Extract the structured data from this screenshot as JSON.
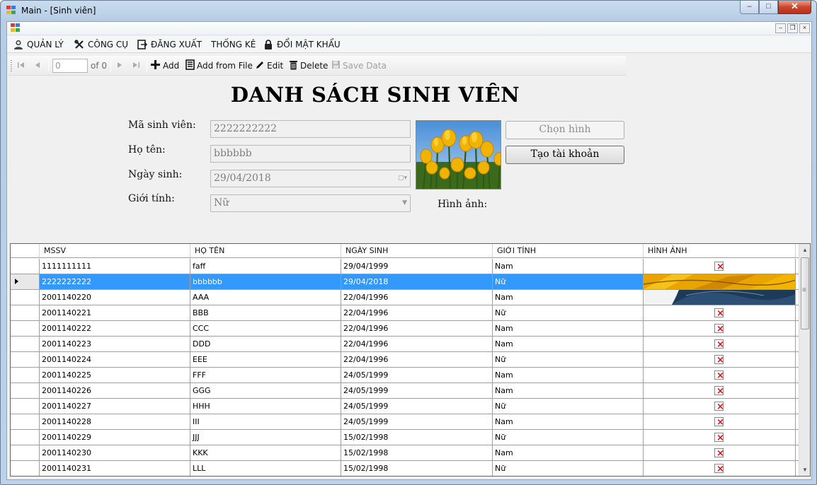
{
  "window": {
    "title": "Main - [Sinh viên]",
    "minimize": "–",
    "restore": "□",
    "close": "✕",
    "mdi_minimize": "–",
    "mdi_restore": "❐",
    "mdi_close": "×"
  },
  "menu": {
    "items": [
      {
        "label": "QUẢN LÝ",
        "icon": "user-icon"
      },
      {
        "label": "CÔNG CỤ",
        "icon": "tools-icon"
      },
      {
        "label": "ĐĂNG XUẤT",
        "icon": "logout-icon"
      },
      {
        "label": "THỐNG KÊ",
        "icon": ""
      },
      {
        "label": "ĐỔI MẬT KHẨU",
        "icon": "lock-icon"
      }
    ]
  },
  "toolbar": {
    "position_value": "0",
    "of_label": "of 0",
    "add_label": "Add",
    "add_from_file_label": "Add from File",
    "edit_label": "Edit",
    "delete_label": "Delete",
    "save_label": "Save Data"
  },
  "form": {
    "heading": "DANH SÁCH SINH VIÊN",
    "student_id_label": "Mã sinh viên:",
    "student_id_value": "2222222222",
    "name_label": "Họ tên:",
    "name_value": "bbbbbb",
    "dob_label": "Ngày sinh:",
    "dob_value": "29/04/2018",
    "gender_label": "Giới tính:",
    "gender_value": "Nữ",
    "image_label": "Hình ảnh:",
    "choose_image_button": "Chọn hình",
    "create_account_button": "Tạo tài khoản"
  },
  "grid": {
    "columns": [
      "MSSV",
      "HỌ TÊN",
      "NGÀY SINH",
      "GIỚI TÍNH",
      "HÌNH ẢNH"
    ],
    "selected_row_index": 1,
    "rows": [
      {
        "mssv": "1111111111",
        "name": "faff",
        "dob": "29/04/1999",
        "gender": "Nam",
        "image": "broken"
      },
      {
        "mssv": "2222222222",
        "name": "bbbbbb",
        "dob": "29/04/2018",
        "gender": "Nữ",
        "image": "photo-top"
      },
      {
        "mssv": "2001140220",
        "name": "AAA",
        "dob": "22/04/1996",
        "gender": "Nam",
        "image": "photo-bottom"
      },
      {
        "mssv": "2001140221",
        "name": "BBB",
        "dob": "22/04/1996",
        "gender": "Nữ",
        "image": "broken"
      },
      {
        "mssv": "2001140222",
        "name": "CCC",
        "dob": "22/04/1996",
        "gender": "Nam",
        "image": "broken"
      },
      {
        "mssv": "2001140223",
        "name": "DDD",
        "dob": "22/04/1996",
        "gender": "Nam",
        "image": "broken"
      },
      {
        "mssv": "2001140224",
        "name": "EEE",
        "dob": "22/04/1996",
        "gender": "Nữ",
        "image": "broken"
      },
      {
        "mssv": "2001140225",
        "name": "FFF",
        "dob": "24/05/1999",
        "gender": "Nam",
        "image": "broken"
      },
      {
        "mssv": "2001140226",
        "name": "GGG",
        "dob": "24/05/1999",
        "gender": "Nam",
        "image": "broken"
      },
      {
        "mssv": "2001140227",
        "name": "HHH",
        "dob": "24/05/1999",
        "gender": "Nữ",
        "image": "broken"
      },
      {
        "mssv": "2001140228",
        "name": "III",
        "dob": "24/05/1999",
        "gender": "Nam",
        "image": "broken"
      },
      {
        "mssv": "2001140229",
        "name": "JJJ",
        "dob": "15/02/1998",
        "gender": "Nữ",
        "image": "broken"
      },
      {
        "mssv": "2001140230",
        "name": "KKK",
        "dob": "15/02/1998",
        "gender": "Nam",
        "image": "broken"
      },
      {
        "mssv": "2001140231",
        "name": "LLL",
        "dob": "15/02/1998",
        "gender": "Nữ",
        "image": "broken"
      }
    ]
  },
  "colors": {
    "selection": "#3399ff",
    "window_frame": "#b7cde6",
    "close_button": "#c9462c"
  }
}
